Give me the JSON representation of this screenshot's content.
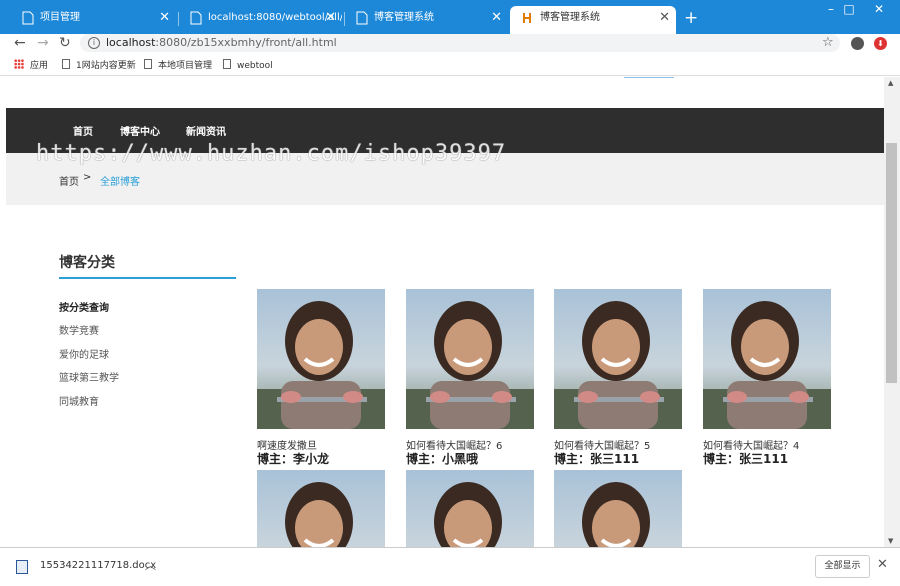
{
  "browser": {
    "tabs": [
      {
        "title": "项目管理",
        "active": false
      },
      {
        "title": "localhost:8080/webtool/all/in",
        "active": false
      },
      {
        "title": "博客管理系统",
        "active": false
      },
      {
        "title": "博客管理系统",
        "active": true
      }
    ],
    "new_tab": "+",
    "window_controls": {
      "minimize": "–",
      "maximize": "□",
      "close": "✕"
    },
    "url_host": "localhost",
    "url_rest": ":8080/zb15xxbmhy/front/all.html",
    "bookmarks": [
      "应用",
      "1网站内容更新",
      "本地项目管理",
      "webtool"
    ]
  },
  "site": {
    "nav": [
      "首页",
      "博客中心",
      "新闻资讯"
    ],
    "watermark": "https://www.huzhan.com/ishop39397",
    "breadcrumb": {
      "home": "首页",
      "sep": ">",
      "current": "全部博客"
    },
    "sidebar": {
      "title": "博客分类",
      "items": [
        "按分类查询",
        "数学竞赛",
        "爱你的足球",
        "篮球第三教学",
        "同城教育"
      ]
    },
    "posts": [
      {
        "title": "啊速度发撒旦",
        "owner": "博主：李小龙"
      },
      {
        "title": "如何看待大国崛起？6",
        "owner": "博主：小黑哦"
      },
      {
        "title": "如何看待大国崛起？5",
        "owner": "博主：张三111"
      },
      {
        "title": "如何看待大国崛起？4",
        "owner": "博主：张三111"
      },
      {
        "title": "",
        "owner": ""
      },
      {
        "title": "",
        "owner": ""
      },
      {
        "title": "",
        "owner": ""
      }
    ]
  },
  "downloads": {
    "file": "15534221117718.docx",
    "show_all": "全部显示"
  },
  "colors": {
    "accent": "#2a9fd8",
    "navbar": "#2e2e2e",
    "chrome_blue": "#1e88d8"
  }
}
